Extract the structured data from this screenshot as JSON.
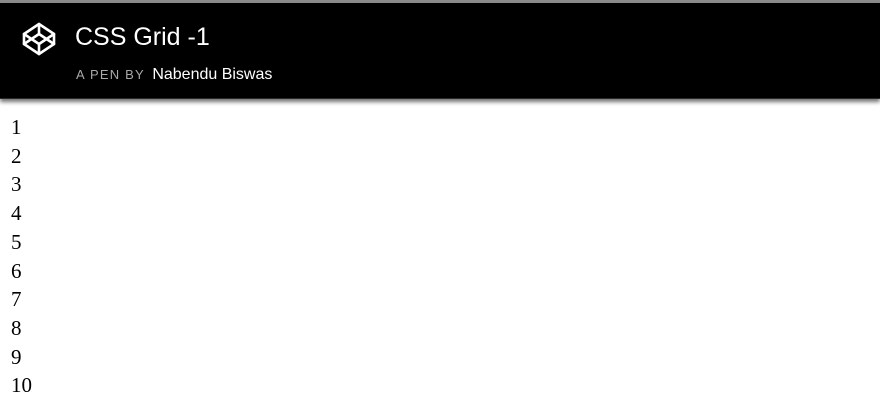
{
  "header": {
    "logo_icon": "codepen-logo-icon",
    "title": "CSS Grid -1",
    "byline_label": "A PEN BY",
    "author": "Nabendu Biswas",
    "background": "#000000",
    "title_color": "#ffffff",
    "byline_color": "#a8a8a8"
  },
  "grid": {
    "items": [
      "1",
      "2",
      "3",
      "4",
      "5",
      "6",
      "7",
      "8",
      "9",
      "10"
    ]
  }
}
